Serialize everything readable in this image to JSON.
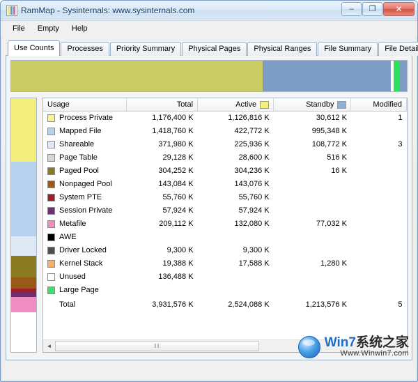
{
  "window": {
    "title": "RamMap - Sysinternals: www.sysinternals.com",
    "icon": "rammap-icon",
    "buttons": {
      "minimize": "–",
      "maximize": "❐",
      "close": "✕"
    }
  },
  "menu": {
    "items": [
      "File",
      "Empty",
      "Help"
    ]
  },
  "tabs": [
    {
      "label": "Use Counts",
      "active": true
    },
    {
      "label": "Processes",
      "active": false
    },
    {
      "label": "Priority Summary",
      "active": false
    },
    {
      "label": "Physical Pages",
      "active": false
    },
    {
      "label": "Physical Ranges",
      "active": false
    },
    {
      "label": "File Summary",
      "active": false
    },
    {
      "label": "File Details",
      "active": false
    }
  ],
  "summary_bar": {
    "segments": [
      {
        "name": "process-private",
        "color": "#c8cc63",
        "width_pct": 63.5
      },
      {
        "name": "standby",
        "color": "#7d9dc4",
        "width_pct": 32.5
      },
      {
        "name": "free",
        "color": "#ffffff",
        "width_pct": 0.7
      },
      {
        "name": "large-page",
        "color": "#2ee05a",
        "width_pct": 1.3
      },
      {
        "name": "tail",
        "color": "#7d9dc4",
        "width_pct": 2.0
      }
    ]
  },
  "color_strip": {
    "segments": [
      {
        "name": "process-private",
        "color": "#f5f07e",
        "height_pct": 25.0
      },
      {
        "name": "mapped-file",
        "color": "#b7d1ef",
        "height_pct": 29.5
      },
      {
        "name": "shareable",
        "color": "#dfe9f5",
        "height_pct": 7.5
      },
      {
        "name": "paged-pool",
        "color": "#8a7a20",
        "height_pct": 8.5
      },
      {
        "name": "nonpaged-pool",
        "color": "#9a5a17",
        "height_pct": 4.5
      },
      {
        "name": "system-pte",
        "color": "#9e1f28",
        "height_pct": 1.6
      },
      {
        "name": "session-private",
        "color": "#6d2e76",
        "height_pct": 1.8
      },
      {
        "name": "metafile",
        "color": "#f08cc0",
        "height_pct": 6.0
      },
      {
        "name": "unused",
        "color": "#ffffff",
        "height_pct": 15.6
      }
    ]
  },
  "grid": {
    "columns": [
      {
        "key": "usage",
        "label": "Usage",
        "swatch": null
      },
      {
        "key": "total",
        "label": "Total",
        "swatch": null
      },
      {
        "key": "active",
        "label": "Active",
        "swatch": "#f5f07e"
      },
      {
        "key": "standby",
        "label": "Standby",
        "swatch": "#8fb0d6"
      },
      {
        "key": "modified",
        "label": "Modified",
        "swatch": null
      }
    ],
    "rows": [
      {
        "color": "#f8f38a",
        "usage": "Process Private",
        "total": "1,176,400 K",
        "active": "1,126,816 K",
        "standby": "30,612 K",
        "modified": "1"
      },
      {
        "color": "#b7d1ef",
        "usage": "Mapped File",
        "total": "1,418,760 K",
        "active": "422,772 K",
        "standby": "995,348 K",
        "modified": ""
      },
      {
        "color": "#dfe9f5",
        "usage": "Shareable",
        "total": "371,980 K",
        "active": "225,936 K",
        "standby": "108,772 K",
        "modified": "3"
      },
      {
        "color": "#d7d7d7",
        "usage": "Page Table",
        "total": "29,128 K",
        "active": "28,600 K",
        "standby": "516 K",
        "modified": ""
      },
      {
        "color": "#8a7a20",
        "usage": "Paged Pool",
        "total": "304,252 K",
        "active": "304,236 K",
        "standby": "16 K",
        "modified": ""
      },
      {
        "color": "#9a5a17",
        "usage": "Nonpaged Pool",
        "total": "143,084 K",
        "active": "143,076 K",
        "standby": "",
        "modified": ""
      },
      {
        "color": "#9e1f28",
        "usage": "System PTE",
        "total": "55,760 K",
        "active": "55,760 K",
        "standby": "",
        "modified": ""
      },
      {
        "color": "#6d2e76",
        "usage": "Session Private",
        "total": "57,924 K",
        "active": "57,924 K",
        "standby": "",
        "modified": ""
      },
      {
        "color": "#f58cbf",
        "usage": "Metafile",
        "total": "209,112 K",
        "active": "132,080 K",
        "standby": "77,032 K",
        "modified": ""
      },
      {
        "color": "#000000",
        "usage": "AWE",
        "total": "",
        "active": "",
        "standby": "",
        "modified": ""
      },
      {
        "color": "#4e4e4e",
        "usage": "Driver Locked",
        "total": "9,300 K",
        "active": "9,300 K",
        "standby": "",
        "modified": ""
      },
      {
        "color": "#f0b36a",
        "usage": "Kernel Stack",
        "total": "19,388 K",
        "active": "17,588 K",
        "standby": "1,280 K",
        "modified": ""
      },
      {
        "color": "#ffffff",
        "usage": "Unused",
        "total": "136,488 K",
        "active": "",
        "standby": "",
        "modified": ""
      },
      {
        "color": "#3ee06a",
        "usage": "Large Page",
        "total": "",
        "active": "",
        "standby": "",
        "modified": ""
      }
    ],
    "total_row": {
      "usage": "Total",
      "total": "3,931,576 K",
      "active": "2,524,088 K",
      "standby": "1,213,576 K",
      "modified": "5"
    },
    "hscroll": {
      "left_arrow": "◄",
      "right_arrow": "►",
      "thumb_grip": "‖‖"
    }
  },
  "watermark": {
    "main_cn": "系统之家",
    "main_prefix": "Win7",
    "sub": "Www.Winwin7.com"
  }
}
